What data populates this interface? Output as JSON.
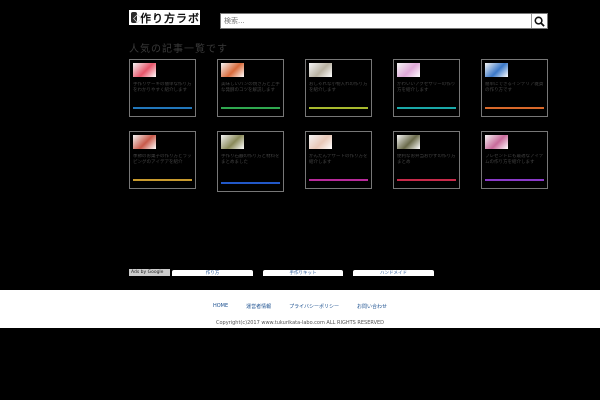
{
  "header": {
    "logo_text": "作り方ラボ",
    "search_placeholder": "検索..."
  },
  "section": {
    "title": "人気の記事一覧です"
  },
  "cards": [
    {
      "title": "手作りケーキの簡単な作り方をわかりやすく紹介します",
      "thumb_color": "#e8556a",
      "line_color": "#2277bb"
    },
    {
      "title": "美味しいパンの焼き方と上手な発酵のコツを解説します",
      "thumb_color": "#d86a3a",
      "line_color": "#2fa84f"
    },
    {
      "title": "おしゃれな小物入れの作り方を紹介します",
      "thumb_color": "#b9b2a2",
      "line_color": "#a8b92e"
    },
    {
      "title": "かわいいアクセサリーの作り方を紹介します",
      "thumb_color": "#e0a8d8",
      "line_color": "#1aa8a8"
    },
    {
      "title": "簡単にできるインテリア雑貨の作り方です",
      "thumb_color": "#3a78c8",
      "line_color": "#d8682a"
    },
    {
      "title": "季節のお菓子の作り方とラッピングのアイデアを紹介",
      "thumb_color": "#c85a4a",
      "line_color": "#c89a2e"
    },
    {
      "title": "手作り石鹸の作り方と材料をまとめました",
      "thumb_color": "#8a8a5a",
      "line_color": "#2258c8"
    },
    {
      "title": "かんたんデザートの作り方を紹介します",
      "thumb_color": "#e8c8b8",
      "line_color": "#b82a9a"
    },
    {
      "title": "便利なお弁当おかずの作り方まとめ",
      "thumb_color": "#6a6a4a",
      "line_color": "#c82a4a"
    },
    {
      "title": "プレゼントにも最適なアイテムの作り方を紹介します",
      "thumb_color": "#c86a9a",
      "line_color": "#8a3ac8"
    }
  ],
  "ads": {
    "badge": "Ads by Google",
    "tabs": [
      "作り方",
      "手作りキット",
      "ハンドメイド"
    ]
  },
  "footer": {
    "nav": [
      "HOME",
      "運営者情報",
      "プライバシーポリシー",
      "お問い合わせ"
    ],
    "copyright": "Copyright(c)2017 www.tukurikata-labo.com ALL RIGHTS RESERVED"
  }
}
